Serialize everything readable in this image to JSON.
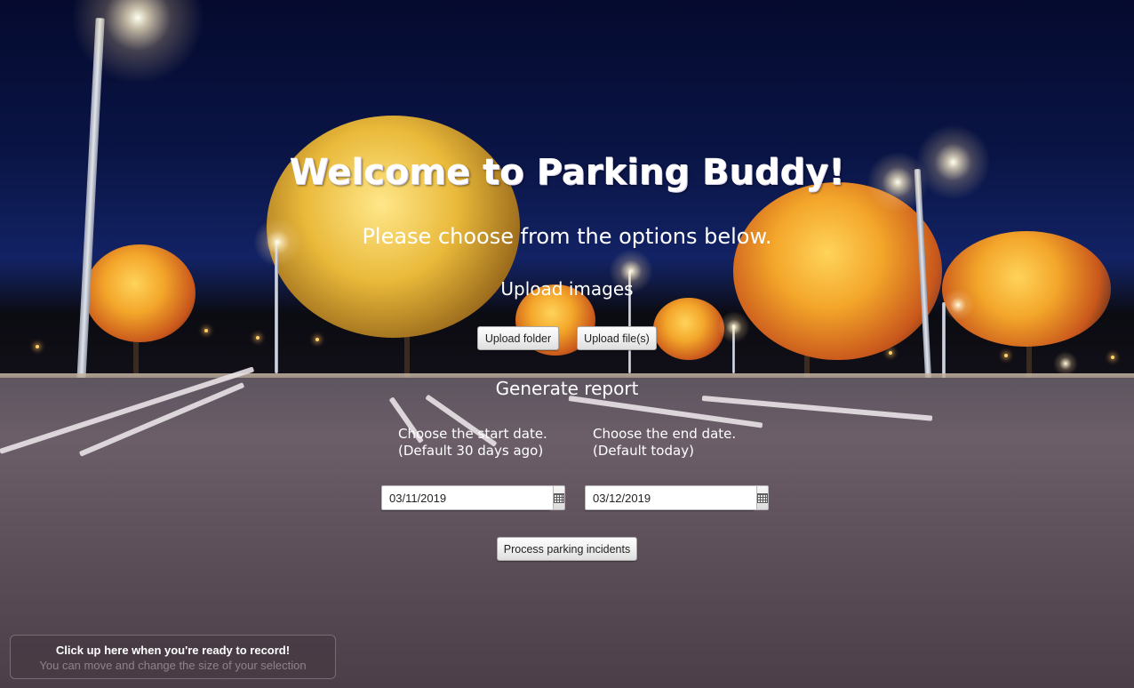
{
  "page": {
    "title": "Welcome to Parking Buddy!",
    "subtitle": "Please choose from the options below."
  },
  "upload": {
    "heading": "Upload images",
    "folder_button": "Upload folder",
    "files_button": "Upload file(s)"
  },
  "report": {
    "heading": "Generate report",
    "start_label_line1": "Choose the start date.",
    "start_label_line2": "(Default 30 days ago)",
    "end_label_line1": "Choose the end date.",
    "end_label_line2": "(Default today)",
    "start_date": "03/11/2019",
    "end_date": "03/12/2019",
    "calendar_icon": "calendar-icon",
    "process_button": "Process parking incidents"
  },
  "recorder": {
    "title": "Click up here when you're ready to record!",
    "subtitle": "You can move and change the size of your selection"
  },
  "colors": {
    "sky": "#0a1546",
    "asphalt": "#5d4f5a",
    "tree_orange": "#f3a62a",
    "text": "#ffffff"
  }
}
